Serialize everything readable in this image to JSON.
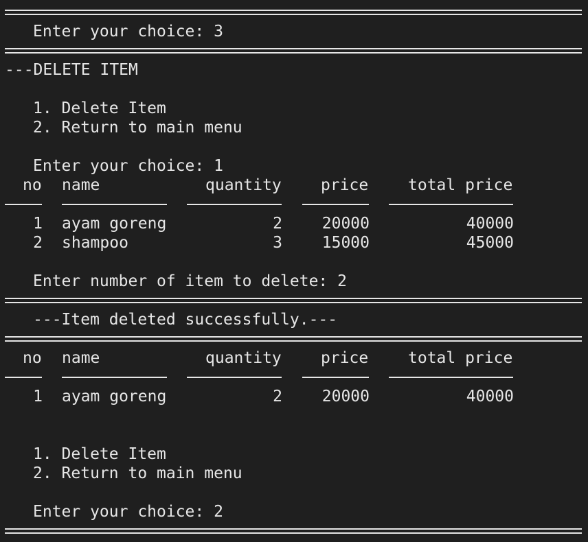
{
  "choice_prompt_1": "Enter your choice: 3",
  "section_title": "---DELETE ITEM",
  "menu_1": {
    "item_1": "1. Delete Item",
    "item_2": "2. Return to main menu",
    "prompt": "Enter your choice: 1"
  },
  "table_headers": {
    "no": "no",
    "name": "name",
    "quantity": "quantity",
    "price": "price",
    "total_price": "total price"
  },
  "table_1": {
    "rows": [
      {
        "no": "1",
        "name": "ayam goreng",
        "quantity": "2",
        "price": "20000",
        "total_price": "40000"
      },
      {
        "no": "2",
        "name": "shampoo",
        "quantity": "3",
        "price": "15000",
        "total_price": "45000"
      }
    ]
  },
  "delete_prompt": "Enter number of item to delete: 2",
  "success_message": "---Item deleted successfully.---",
  "table_2": {
    "rows": [
      {
        "no": "1",
        "name": "ayam goreng",
        "quantity": "2",
        "price": "20000",
        "total_price": "40000"
      }
    ]
  },
  "menu_2": {
    "item_1": "1. Delete Item",
    "item_2": "2. Return to main menu",
    "prompt": "Enter your choice: 2"
  }
}
